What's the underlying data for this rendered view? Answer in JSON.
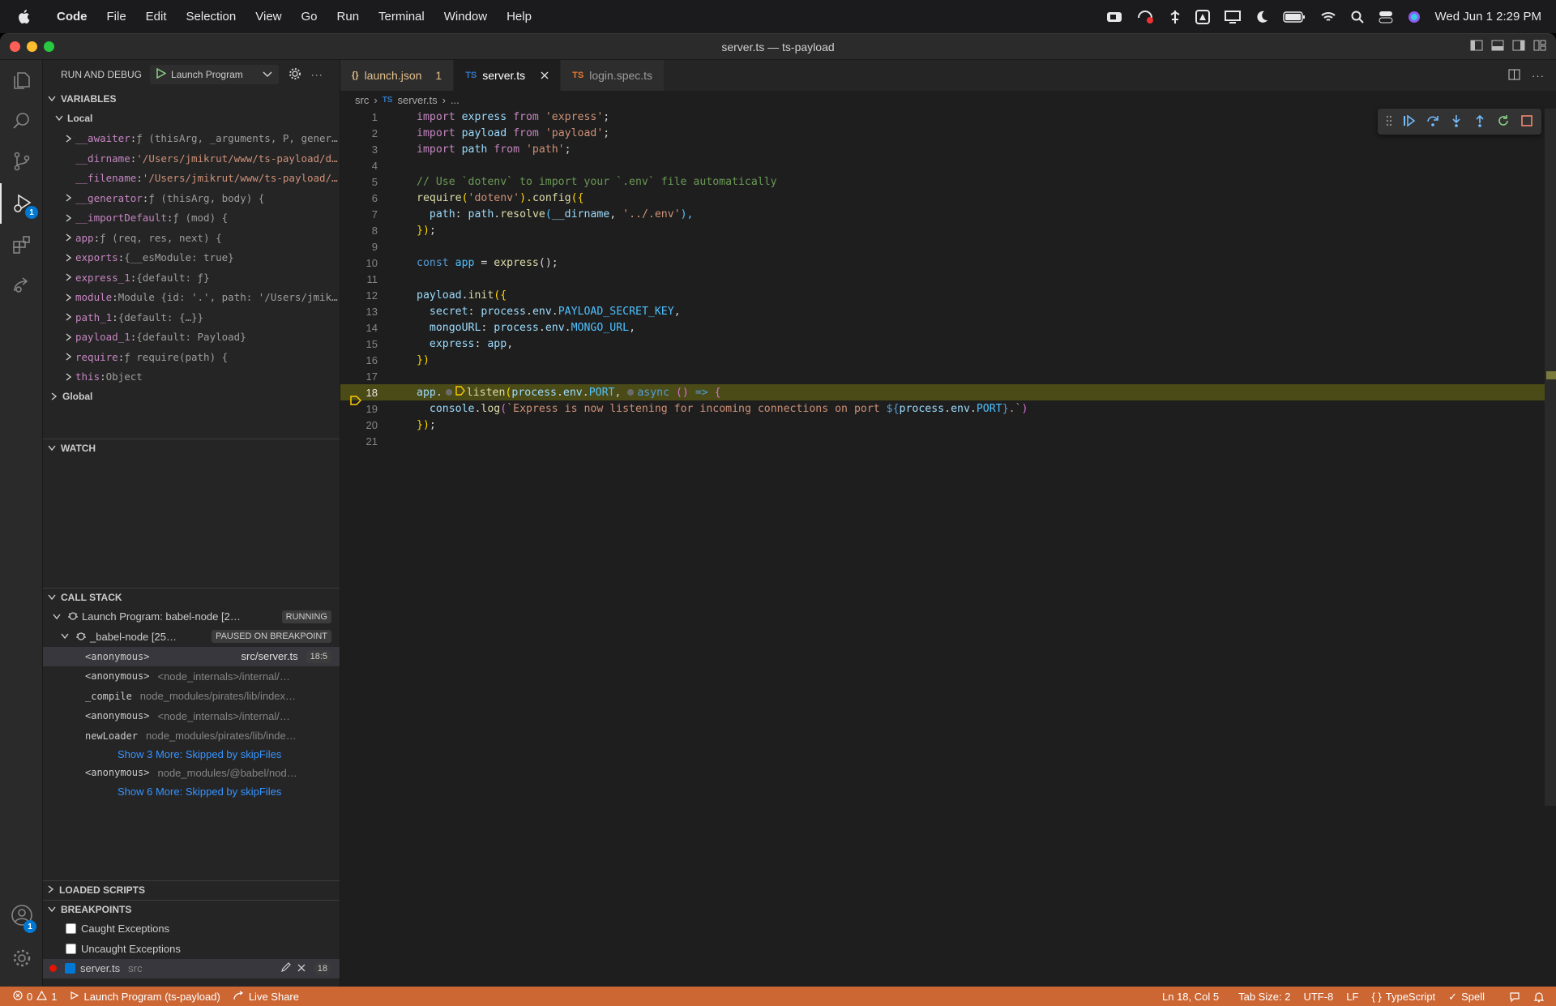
{
  "menubar": {
    "app": "Code",
    "items": [
      "File",
      "Edit",
      "Selection",
      "View",
      "Go",
      "Run",
      "Terminal",
      "Window",
      "Help"
    ],
    "clock": "Wed Jun 1  2:29 PM"
  },
  "window": {
    "title": "server.ts — ts-payload"
  },
  "activity_badges": {
    "debug": "1",
    "accounts": "1"
  },
  "sidebar": {
    "header": "RUN AND DEBUG",
    "config": "Launch Program",
    "variables_title": "VARIABLES",
    "local_label": "Local",
    "variables": [
      {
        "name": "__awaiter",
        "value": "ƒ (thisArg, _arguments, P, gener…",
        "expandable": true,
        "kind": "val"
      },
      {
        "name": "__dirname",
        "value": "'/Users/jmikrut/www/ts-payload/d…",
        "expandable": false,
        "kind": "str"
      },
      {
        "name": "__filename",
        "value": "'/Users/jmikrut/www/ts-payload/…",
        "expandable": false,
        "kind": "str"
      },
      {
        "name": "__generator",
        "value": "ƒ (thisArg, body) {",
        "expandable": true,
        "kind": "val"
      },
      {
        "name": "__importDefault",
        "value": "ƒ (mod) {",
        "expandable": true,
        "kind": "val"
      },
      {
        "name": "app",
        "value": "ƒ (req, res, next) {",
        "expandable": true,
        "kind": "val"
      },
      {
        "name": "exports",
        "value": "{__esModule: true}",
        "expandable": true,
        "kind": "val"
      },
      {
        "name": "express_1",
        "value": "{default: ƒ}",
        "expandable": true,
        "kind": "val"
      },
      {
        "name": "module",
        "value": "Module {id: '.', path: '/Users/jmik…",
        "expandable": true,
        "kind": "val"
      },
      {
        "name": "path_1",
        "value": "{default: {…}}",
        "expandable": true,
        "kind": "val"
      },
      {
        "name": "payload_1",
        "value": "{default: Payload}",
        "expandable": true,
        "kind": "val"
      },
      {
        "name": "require",
        "value": "ƒ require(path) {",
        "expandable": true,
        "kind": "val"
      },
      {
        "name": "this",
        "value": "Object",
        "expandable": true,
        "kind": "val"
      }
    ],
    "global_label": "Global",
    "watch_title": "WATCH",
    "callstack_title": "CALL STACK",
    "process": {
      "name": "Launch Program: babel-node [2…",
      "state": "RUNNING"
    },
    "thread": {
      "name": "_babel-node [25…",
      "state": "PAUSED ON BREAKPOINT"
    },
    "frames": [
      {
        "fn": "<anonymous>",
        "src": "src/server.ts",
        "pos": "18:5",
        "selected": true
      },
      {
        "fn": "<anonymous>",
        "src": "<node_internals>/internal/…",
        "pos": "",
        "selected": false
      },
      {
        "fn": "_compile",
        "src": "node_modules/pirates/lib/index…",
        "pos": "",
        "selected": false
      },
      {
        "fn": "<anonymous>",
        "src": "<node_internals>/internal/…",
        "pos": "",
        "selected": false
      },
      {
        "fn": "newLoader",
        "src": "node_modules/pirates/lib/inde…",
        "pos": "",
        "selected": false
      }
    ],
    "skip1": "Show 3 More: Skipped by skipFiles",
    "frame_extra": {
      "fn": "<anonymous>",
      "src": "node_modules/@babel/nod…"
    },
    "skip2": "Show 6 More: Skipped by skipFiles",
    "loaded_title": "LOADED SCRIPTS",
    "breakpoints_title": "BREAKPOINTS",
    "bp_caught": "Caught Exceptions",
    "bp_uncaught": "Uncaught Exceptions",
    "bp_file": "server.ts",
    "bp_folder": "src",
    "bp_line": "18"
  },
  "tabs": [
    {
      "icon": "{}",
      "label": "launch.json",
      "extra": "1",
      "active": false,
      "color": "#e2c08d"
    },
    {
      "icon": "TS",
      "label": "server.ts",
      "extra": "",
      "active": true,
      "color": "#ffffff"
    },
    {
      "icon": "TS",
      "label": "login.spec.ts",
      "extra": "",
      "active": false,
      "color": "#9d9d9d"
    }
  ],
  "breadcrumb": {
    "folder": "src",
    "file": "server.ts",
    "more": "..."
  },
  "code_lines": [
    "1",
    "2",
    "3",
    "4",
    "5",
    "6",
    "7",
    "8",
    "9",
    "10",
    "11",
    "12",
    "13",
    "14",
    "15",
    "16",
    "17",
    "18",
    "19",
    "20",
    "21"
  ],
  "code": {
    "l1": [
      "import",
      " express ",
      "from",
      " 'express'",
      ";"
    ],
    "l2": [
      "import",
      " payload ",
      "from",
      " 'payload'",
      ";"
    ],
    "l3": [
      "import",
      " path ",
      "from",
      " 'path'",
      ";"
    ],
    "l5": "// Use `dotenv` to import your `.env` file automatically",
    "l6": [
      "require",
      "(",
      "'dotenv'",
      ").",
      "config",
      "({"
    ],
    "l7": [
      "  path",
      ": ",
      "path",
      ".",
      "resolve",
      "(",
      "__dirname",
      ", ",
      "'../.env'",
      "),"
    ],
    "l8": [
      "})",
      ";"
    ],
    "l10": [
      "const",
      " app ",
      "= ",
      "express",
      "();"
    ],
    "l12": [
      "payload",
      ".",
      "init",
      "({"
    ],
    "l13": [
      "  secret",
      ": ",
      "process",
      ".",
      "env",
      ".",
      "PAYLOAD_SECRET_KEY",
      ","
    ],
    "l14": [
      "  mongoURL",
      ": ",
      "process",
      ".",
      "env",
      ".",
      "MONGO_URL",
      ","
    ],
    "l15": [
      "  express",
      ": ",
      "app",
      ","
    ],
    "l16": [
      "})"
    ],
    "l18": [
      "app",
      ".",
      "listen",
      "(",
      "process",
      ".",
      "env",
      ".",
      "PORT",
      ", ",
      "async",
      " () ",
      "=>",
      " {"
    ],
    "l19": [
      "  console",
      ".",
      "log",
      "(",
      "`Express is now listening for incoming connections on port ",
      "${",
      "process",
      ".",
      "env",
      ".",
      "PORT",
      "}",
      ".`",
      ")"
    ],
    "l20": [
      "})",
      ";"
    ]
  },
  "status": {
    "errors": "0",
    "warnings": "1",
    "launch": "Launch Program (ts-payload)",
    "liveshare": "Live Share",
    "position": "Ln 18, Col 5",
    "tabsize": "Tab Size: 2",
    "encoding": "UTF-8",
    "eol": "LF",
    "language": "TypeScript",
    "spell": "Spell"
  }
}
